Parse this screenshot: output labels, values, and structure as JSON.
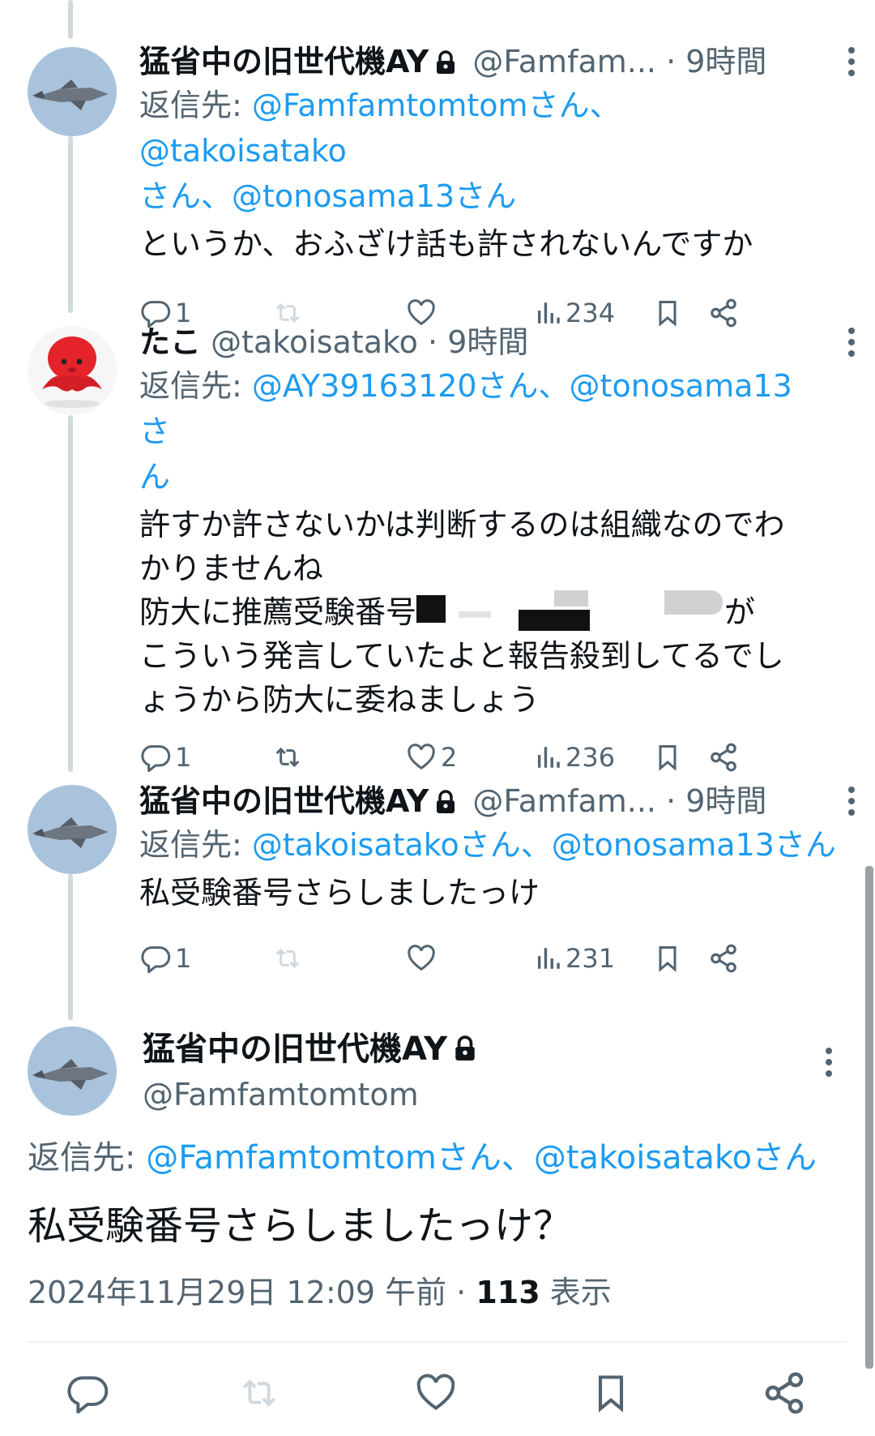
{
  "tweets": [
    {
      "name": "猛省中の旧世代機AY",
      "handle": "@Famfam...",
      "time": "· 9時間",
      "reply_prefix": "返信先: ",
      "reply_links": "@Famfamtomtomさん、@takoisatako",
      "reply_links_2": "さん、@tonosama13さん",
      "text": "というか、おふざけ話も許されないんですか",
      "replies": "1",
      "retweets": "",
      "likes": "",
      "views": "234"
    },
    {
      "name": "たこ",
      "handle": "@takoisatako",
      "time": "· 9時間",
      "reply_prefix": "返信先: ",
      "reply_links": "@AY39163120さん、@tonosama13さ",
      "reply_links_2": "ん",
      "text_line1": "許すか許さないかは判断するのは組織なのでわ",
      "text_line2": "かりませんね",
      "text_line3a": "防大に推薦受験番号",
      "text_line3b": "が",
      "text_line4": "こういう発言していたよと報告殺到してるでし",
      "text_line5": "ょうから防大に委ねましょう",
      "replies": "1",
      "retweets": "",
      "likes": "2",
      "views": "236"
    },
    {
      "name": "猛省中の旧世代機AY",
      "handle": "@Famfam...",
      "time": "· 9時間",
      "reply_prefix": "返信先: ",
      "reply_links": "@takoisatakoさん、@tonosama13さん",
      "text": "私受験番号さらしましたっけ",
      "replies": "1",
      "retweets": "",
      "likes": "",
      "views": "231"
    }
  ],
  "main": {
    "name": "猛省中の旧世代機AY",
    "handle": "@Famfamtomtom",
    "reply_prefix": "返信先: ",
    "reply_links": "@Famfamtomtomさん、@takoisatakoさん",
    "text": "私受験番号さらしましたっけ？",
    "meta_date": "2024年11月29日 12:09 午前 · ",
    "meta_views_count": "113",
    "meta_views_label": " 表示"
  },
  "colors": {
    "link": "#1d9bf0",
    "secondary": "#536471",
    "primary": "#0f1419",
    "thread_line": "#cfd9de"
  },
  "icons": [
    "lock-icon",
    "more-icon",
    "reply-icon",
    "retweet-icon",
    "like-icon",
    "views-icon",
    "bookmark-icon",
    "share-icon"
  ]
}
